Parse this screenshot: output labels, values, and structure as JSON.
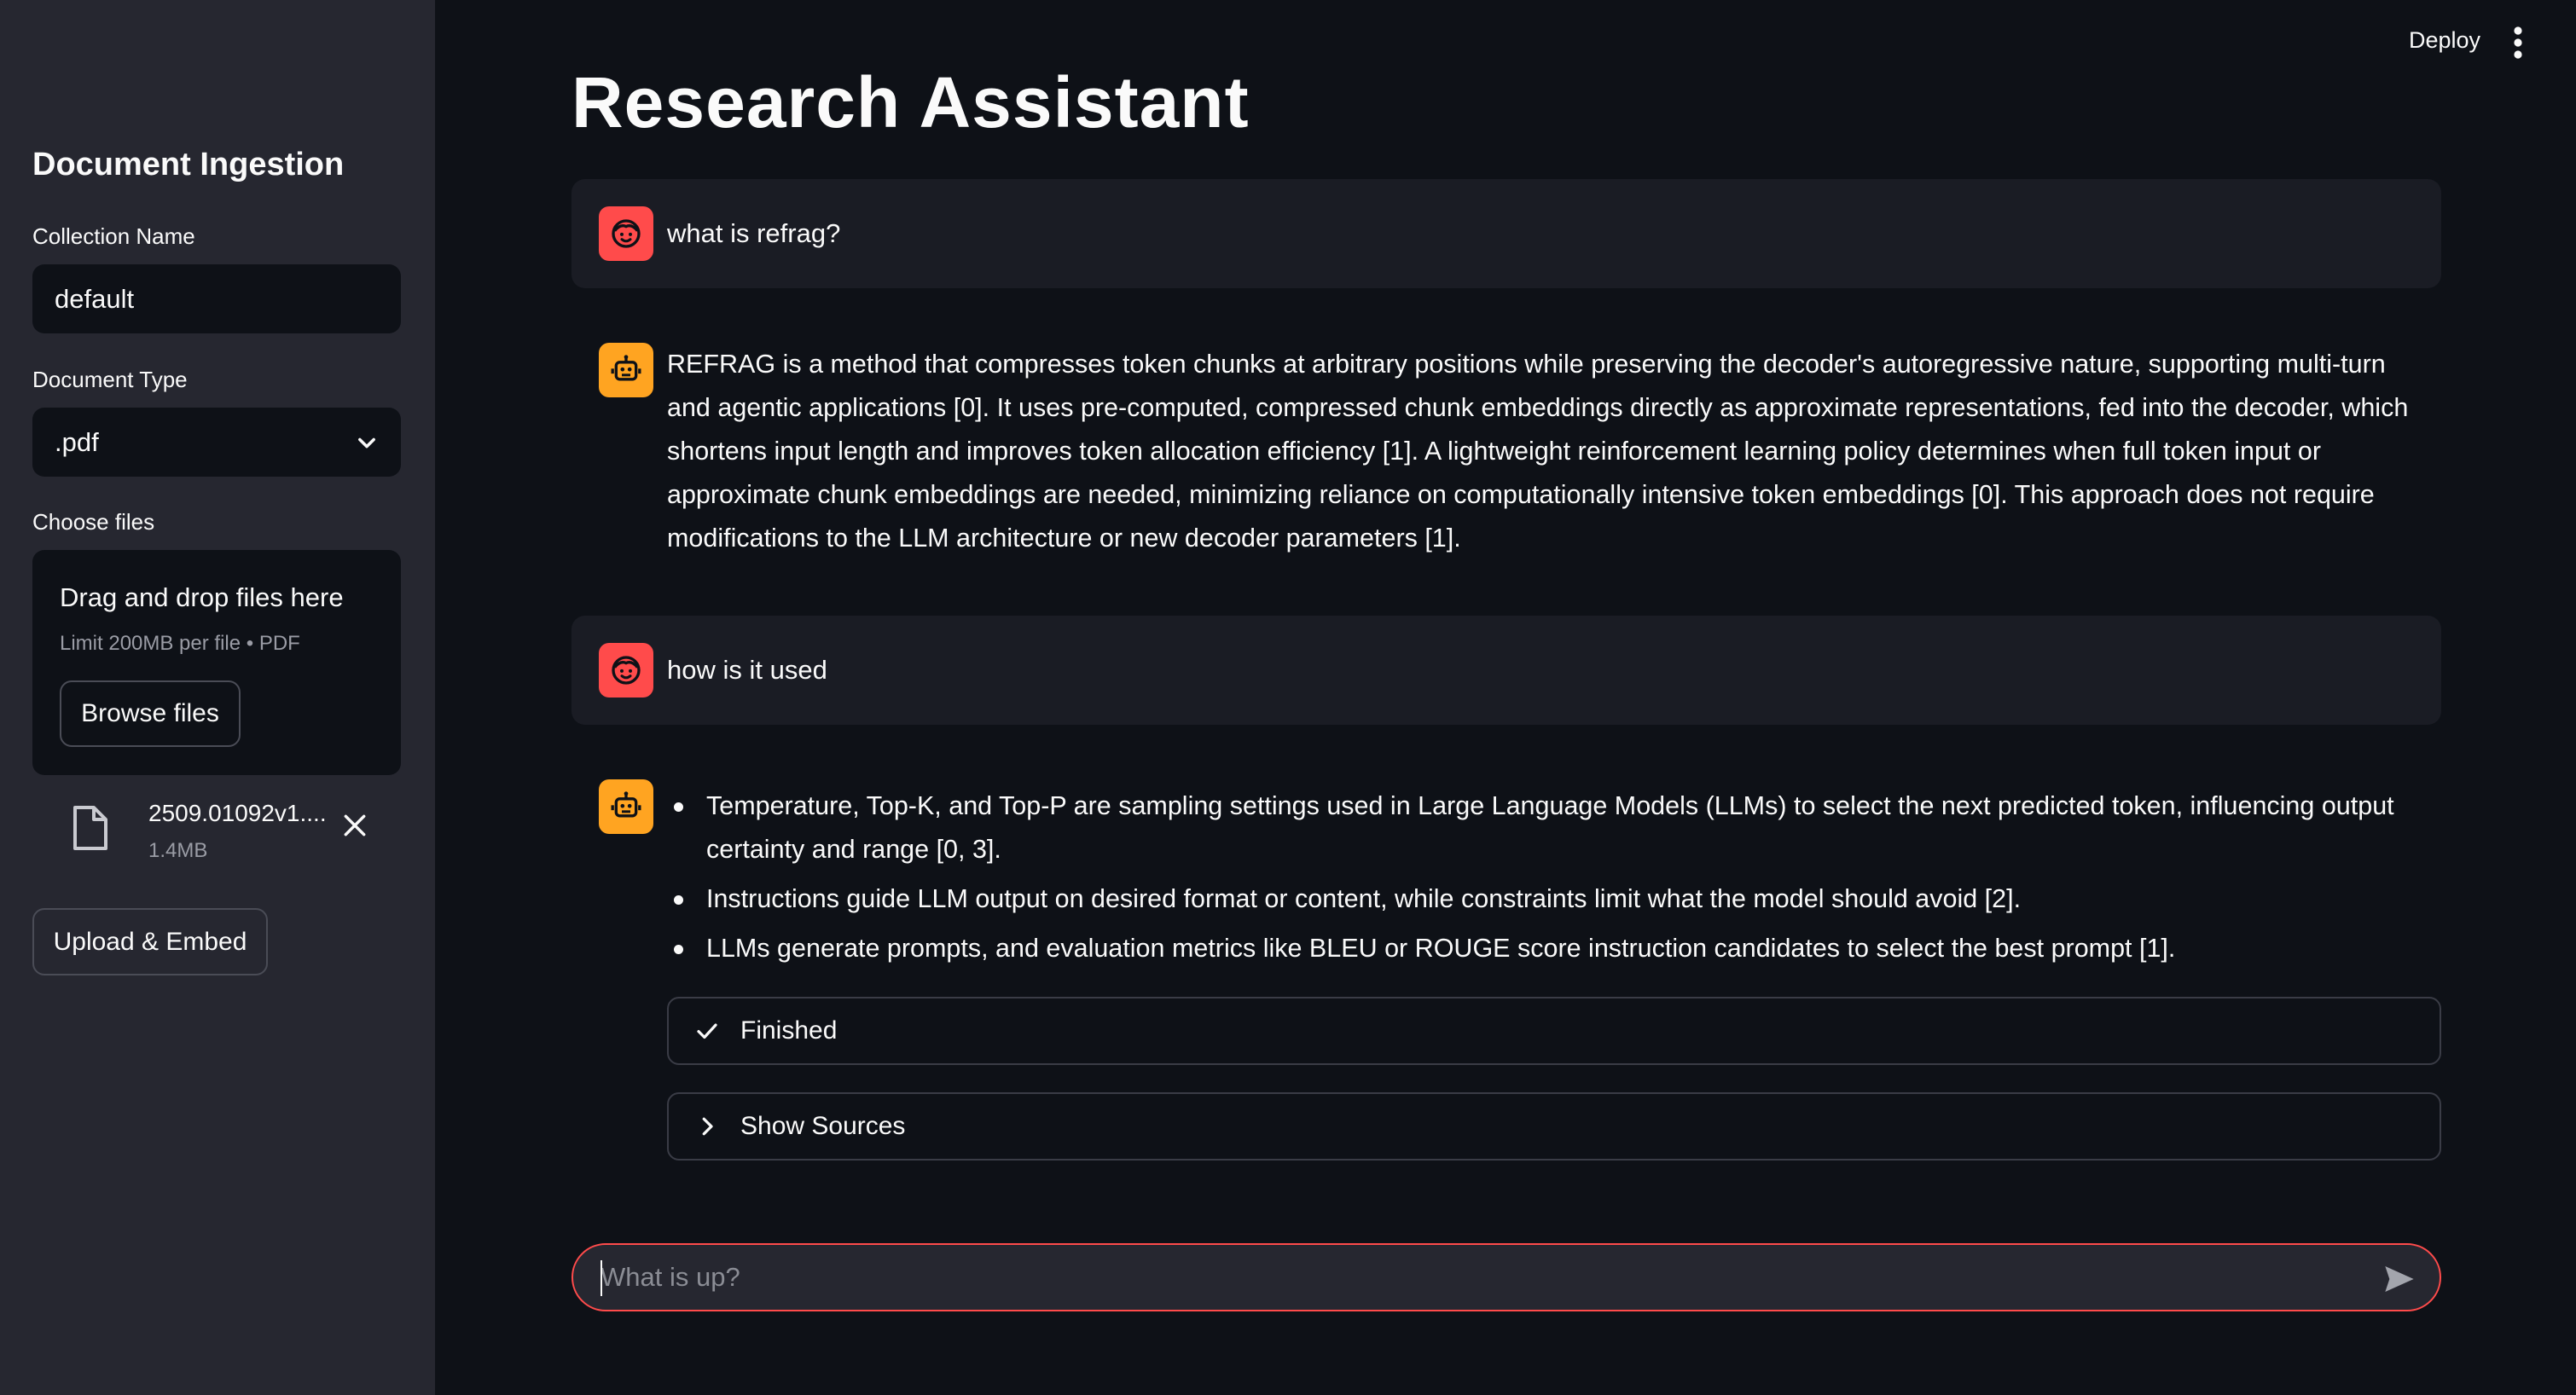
{
  "sidebar": {
    "title": "Document Ingestion",
    "collection_label": "Collection Name",
    "collection_value": "default",
    "doctype_label": "Document Type",
    "doctype_value": ".pdf",
    "choose_label": "Choose files",
    "dropzone_title": "Drag and drop files here",
    "dropzone_limit": "Limit 200MB per file • PDF",
    "browse_label": "Browse files",
    "file": {
      "name": "2509.01092v1....",
      "size": "1.4MB"
    },
    "upload_label": "Upload & Embed"
  },
  "header": {
    "deploy_label": "Deploy"
  },
  "main": {
    "title": "Research Assistant",
    "messages": [
      {
        "role": "user",
        "text": "what is refrag?"
      },
      {
        "role": "assistant",
        "text": "REFRAG is a method that compresses token chunks at arbitrary positions while preserving the decoder's autoregressive nature, supporting multi-turn and agentic applications [0]. It uses pre-computed, compressed chunk embeddings directly as approximate representations, fed into the decoder, which shortens input length and improves token allocation efficiency [1]. A lightweight reinforcement learning policy determines when full token input or approximate chunk embeddings are needed, minimizing reliance on computationally intensive token embeddings [0]. This approach does not require modifications to the LLM architecture or new decoder parameters [1]."
      },
      {
        "role": "user",
        "text": "how is it used"
      },
      {
        "role": "assistant",
        "bullets": [
          "Temperature, Top-K, and Top-P are sampling settings used in Large Language Models (LLMs) to select the next predicted token, influencing output certainty and range [0, 3].",
          "Instructions guide LLM output on desired format or content, while constraints limit what the model should avoid [2].",
          "LLMs generate prompts, and evaluation metrics like BLEU or ROUGE score instruction candidates to select the best prompt [1]."
        ]
      }
    ],
    "status_label": "Finished",
    "sources_label": "Show Sources",
    "chat_placeholder": "What is up?"
  },
  "colors": {
    "accent": "#ff4b4b",
    "bot_avatar": "#ffa421",
    "sidebar_bg": "#262730",
    "main_bg": "#0e1117"
  },
  "icons": {
    "avatar_user": "smile-face-icon",
    "avatar_bot": "robot-icon",
    "file": "file-icon",
    "remove": "close-icon",
    "status": "check-icon",
    "expander": "chevron-right-icon",
    "send": "send-icon",
    "menu": "kebab-menu-icon",
    "select": "chevron-down-icon"
  }
}
